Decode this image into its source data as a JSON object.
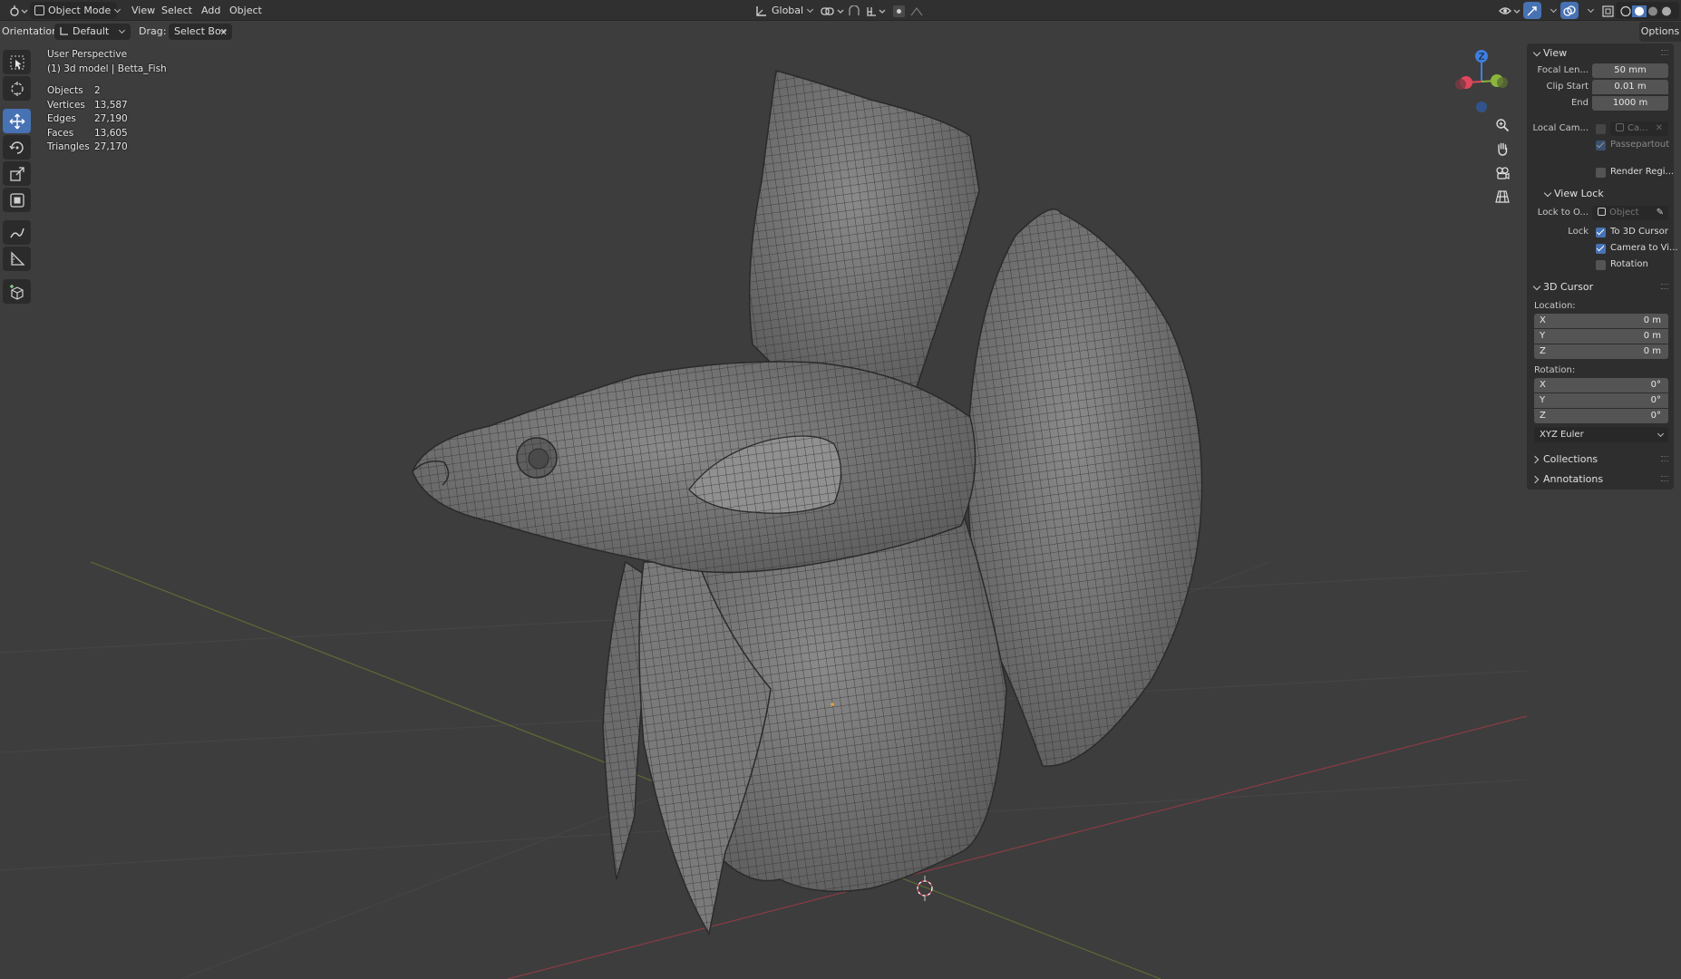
{
  "header": {
    "mode": "Object Mode",
    "menus": [
      "View",
      "Select",
      "Add",
      "Object"
    ],
    "transform_orientation": "Global"
  },
  "toolbar_header": {
    "orientation_label": "Orientation:",
    "orientation_value": "Default",
    "drag_label": "Drag:",
    "drag_value": "Select Box",
    "options_label": "Options"
  },
  "overlay": {
    "view_name": "User Perspective",
    "object_name": "(1) 3d model | Betta_Fish",
    "stats": [
      {
        "label": "Objects",
        "value": "2"
      },
      {
        "label": "Vertices",
        "value": "13,587"
      },
      {
        "label": "Edges",
        "value": "27,190"
      },
      {
        "label": "Faces",
        "value": "13,605"
      },
      {
        "label": "Triangles",
        "value": "27,170"
      }
    ]
  },
  "gizmo": {
    "z_label": "Z"
  },
  "panel": {
    "view": {
      "title": "View",
      "focal_length_label": "Focal Len...",
      "focal_length_value": "50 mm",
      "clip_start_label": "Clip Start",
      "clip_start_value": "0.01 m",
      "clip_end_label": "End",
      "clip_end_value": "1000 m",
      "local_camera_label": "Local Cam...",
      "local_camera_value": "Ca...",
      "passepartout_label": "Passepartout",
      "render_region_label": "Render Regi..."
    },
    "view_lock": {
      "title": "View Lock",
      "lock_to_object_label": "Lock to O...",
      "lock_to_object_placeholder": "Object",
      "lock_label": "Lock",
      "to_3d_cursor_label": "To 3D Cursor",
      "camera_to_view_label": "Camera to Vi...",
      "rotation_label": "Rotation"
    },
    "cursor": {
      "title": "3D Cursor",
      "location_label": "Location:",
      "location": [
        {
          "axis": "X",
          "value": "0 m"
        },
        {
          "axis": "Y",
          "value": "0 m"
        },
        {
          "axis": "Z",
          "value": "0 m"
        }
      ],
      "rotation_label": "Rotation:",
      "rotation": [
        {
          "axis": "X",
          "value": "0°"
        },
        {
          "axis": "Y",
          "value": "0°"
        },
        {
          "axis": "Z",
          "value": "0°"
        }
      ],
      "rotation_mode": "XYZ Euler"
    },
    "collections_title": "Collections",
    "annotations_title": "Annotations"
  },
  "colors": {
    "accent": "#4772b3",
    "background": "#3d3d3d",
    "header": "#303030",
    "axis_x": "#e0475c",
    "axis_y": "#8bb53b",
    "axis_z": "#3f7fe0"
  }
}
